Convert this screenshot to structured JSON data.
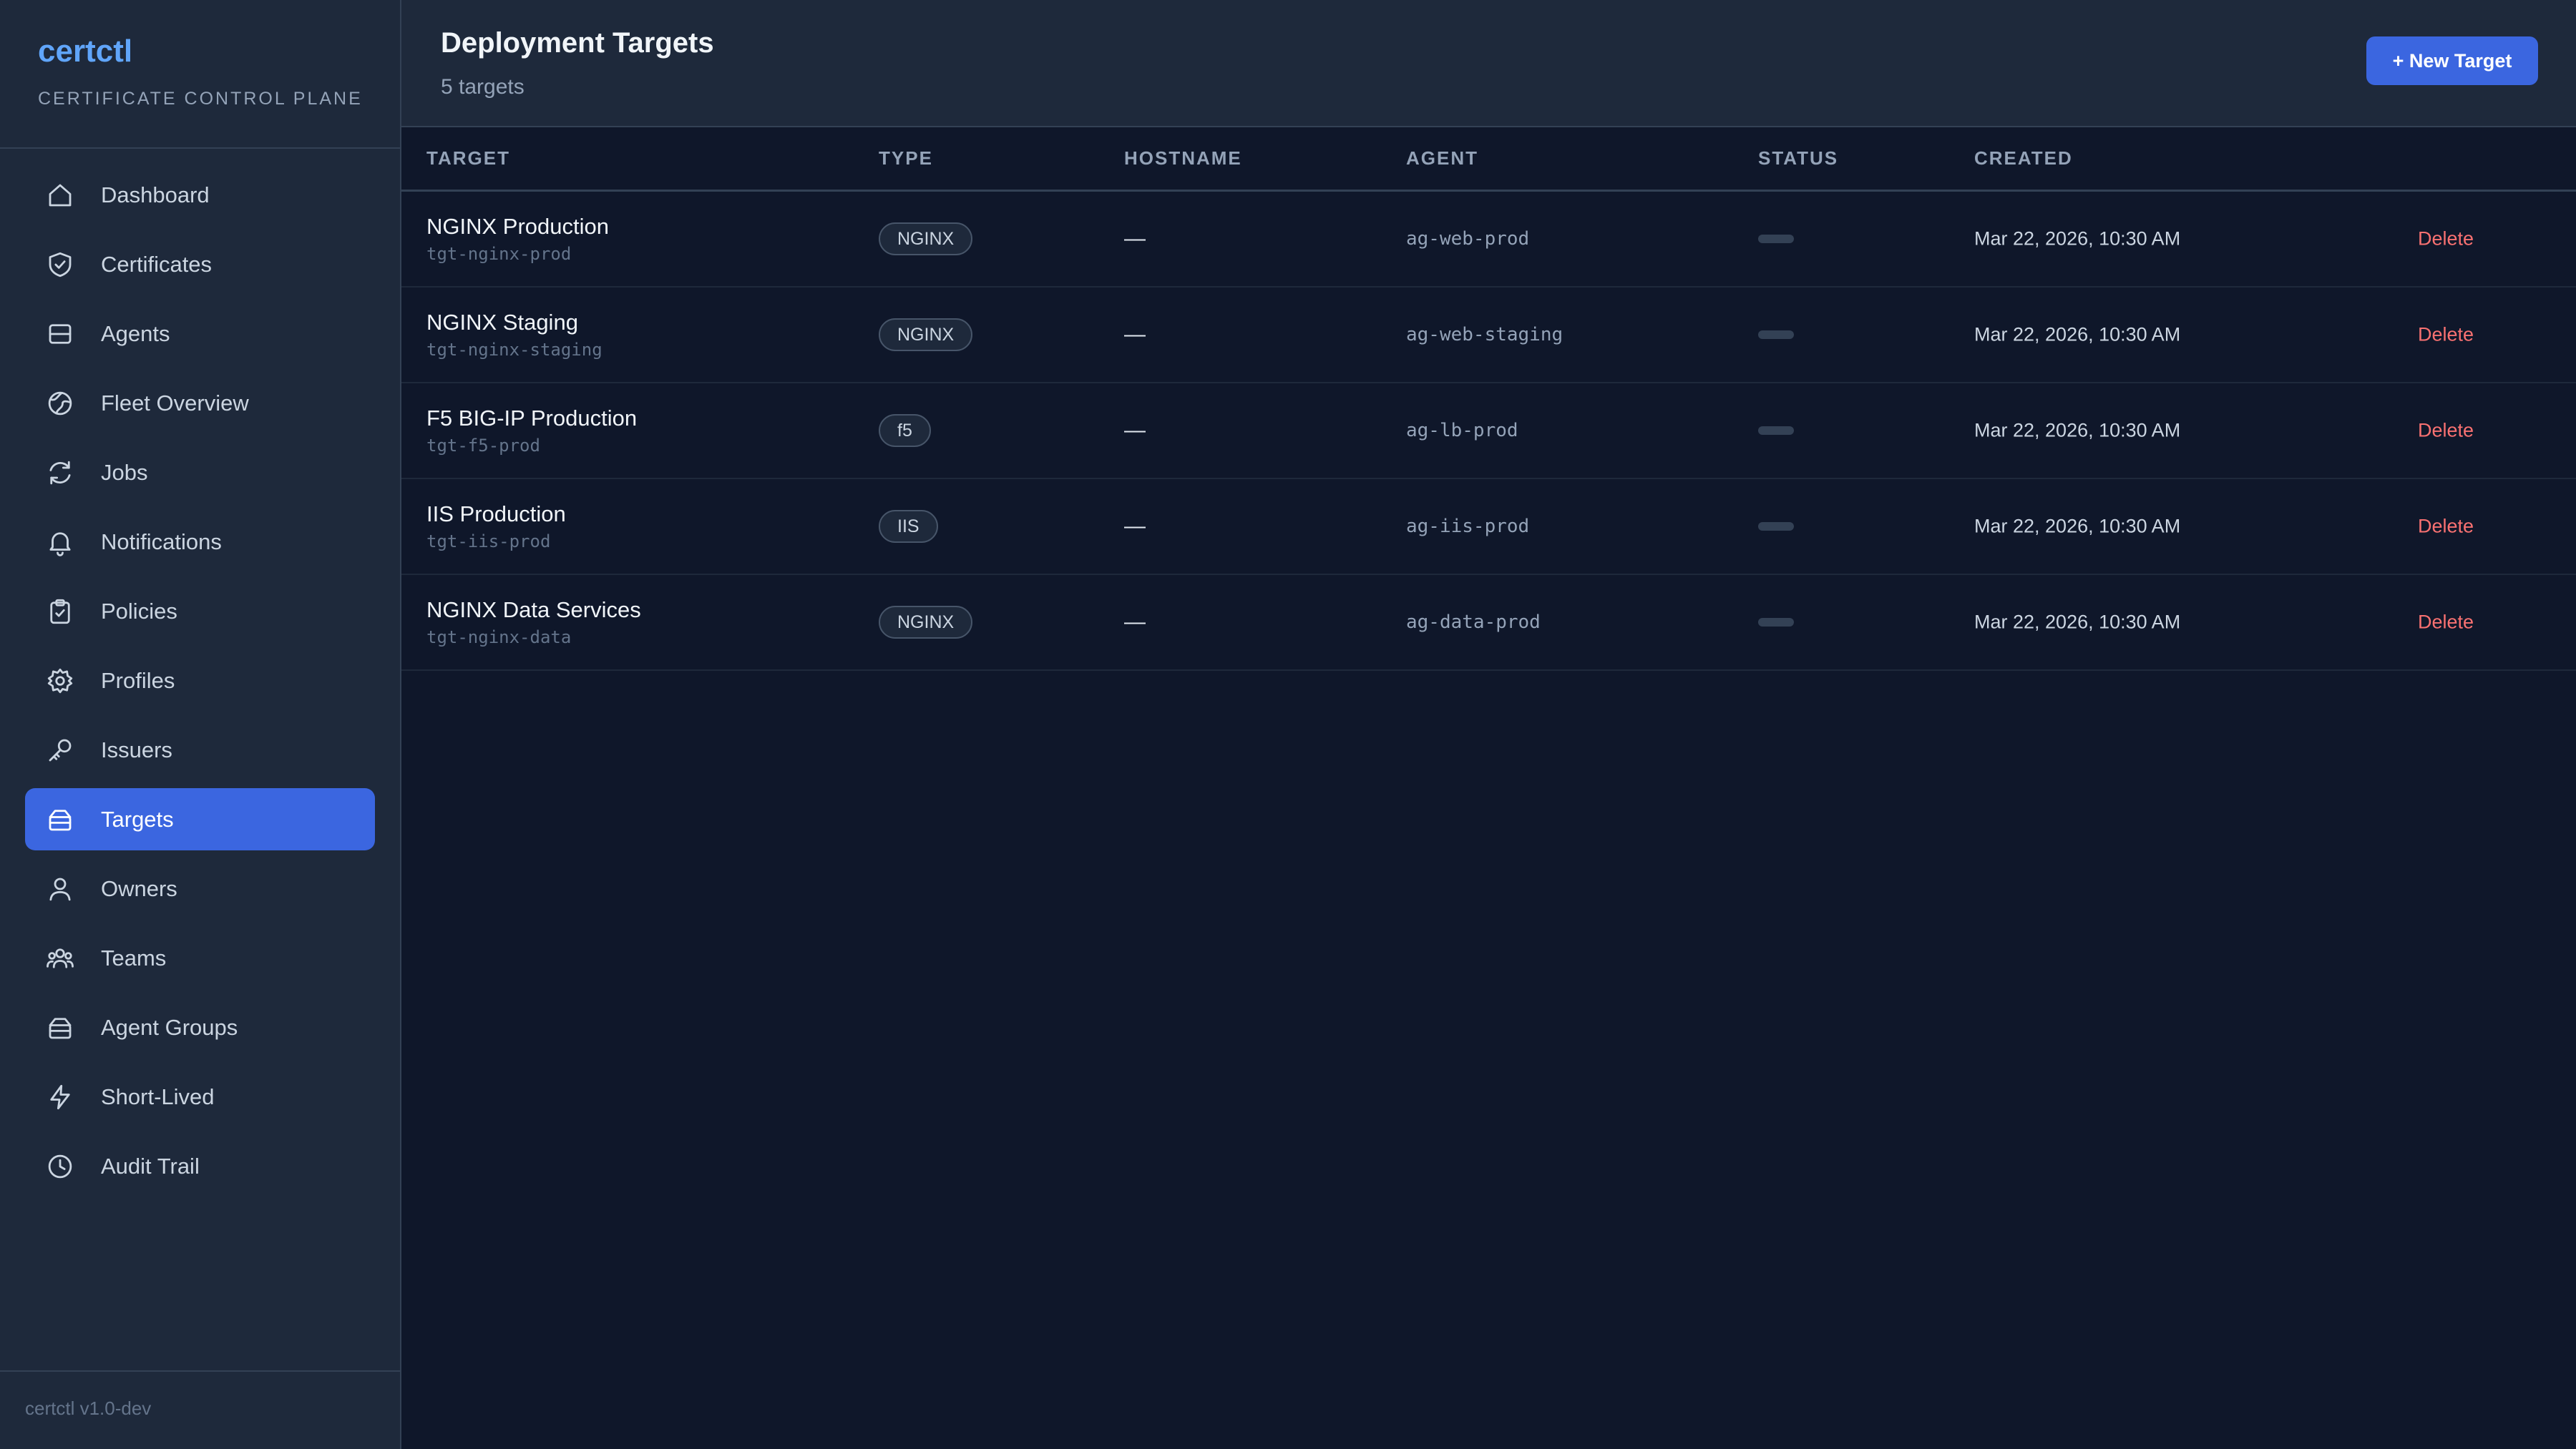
{
  "brand": {
    "name": "certctl",
    "subtitle": "CERTIFICATE CONTROL PLANE"
  },
  "sidebar": {
    "items": [
      {
        "label": "Dashboard",
        "icon": "home-icon"
      },
      {
        "label": "Certificates",
        "icon": "shield-icon"
      },
      {
        "label": "Agents",
        "icon": "server-icon"
      },
      {
        "label": "Fleet Overview",
        "icon": "globe-icon"
      },
      {
        "label": "Jobs",
        "icon": "refresh-icon"
      },
      {
        "label": "Notifications",
        "icon": "bell-icon"
      },
      {
        "label": "Policies",
        "icon": "clipboard-check-icon"
      },
      {
        "label": "Profiles",
        "icon": "gear-icon"
      },
      {
        "label": "Issuers",
        "icon": "key-icon"
      },
      {
        "label": "Targets",
        "icon": "stack-icon",
        "active": true
      },
      {
        "label": "Owners",
        "icon": "user-icon"
      },
      {
        "label": "Teams",
        "icon": "users-icon"
      },
      {
        "label": "Agent Groups",
        "icon": "stack-icon"
      },
      {
        "label": "Short-Lived",
        "icon": "lightning-icon"
      },
      {
        "label": "Audit Trail",
        "icon": "clock-icon"
      }
    ],
    "footer": "certctl v1.0-dev"
  },
  "header": {
    "title": "Deployment Targets",
    "count": "5 targets",
    "new_button": "+ New Target"
  },
  "table": {
    "columns": [
      "TARGET",
      "TYPE",
      "HOSTNAME",
      "AGENT",
      "STATUS",
      "CREATED"
    ],
    "rows": [
      {
        "name": "NGINX Production",
        "id": "tgt-nginx-prod",
        "type": "NGINX",
        "hostname": "—",
        "agent": "ag-web-prod",
        "created": "Mar 22, 2026, 10:30 AM",
        "action": "Delete"
      },
      {
        "name": "NGINX Staging",
        "id": "tgt-nginx-staging",
        "type": "NGINX",
        "hostname": "—",
        "agent": "ag-web-staging",
        "created": "Mar 22, 2026, 10:30 AM",
        "action": "Delete"
      },
      {
        "name": "F5 BIG-IP Production",
        "id": "tgt-f5-prod",
        "type": "f5",
        "hostname": "—",
        "agent": "ag-lb-prod",
        "created": "Mar 22, 2026, 10:30 AM",
        "action": "Delete"
      },
      {
        "name": "IIS Production",
        "id": "tgt-iis-prod",
        "type": "IIS",
        "hostname": "—",
        "agent": "ag-iis-prod",
        "created": "Mar 22, 2026, 10:30 AM",
        "action": "Delete"
      },
      {
        "name": "NGINX Data Services",
        "id": "tgt-nginx-data",
        "type": "NGINX",
        "hostname": "—",
        "agent": "ag-data-prod",
        "created": "Mar 22, 2026, 10:30 AM",
        "action": "Delete"
      }
    ]
  },
  "colors": {
    "accent": "#3b66e0",
    "brand": "#60a5fa",
    "danger": "#f87171",
    "background": "#0f172a",
    "panel": "#1e293b"
  }
}
